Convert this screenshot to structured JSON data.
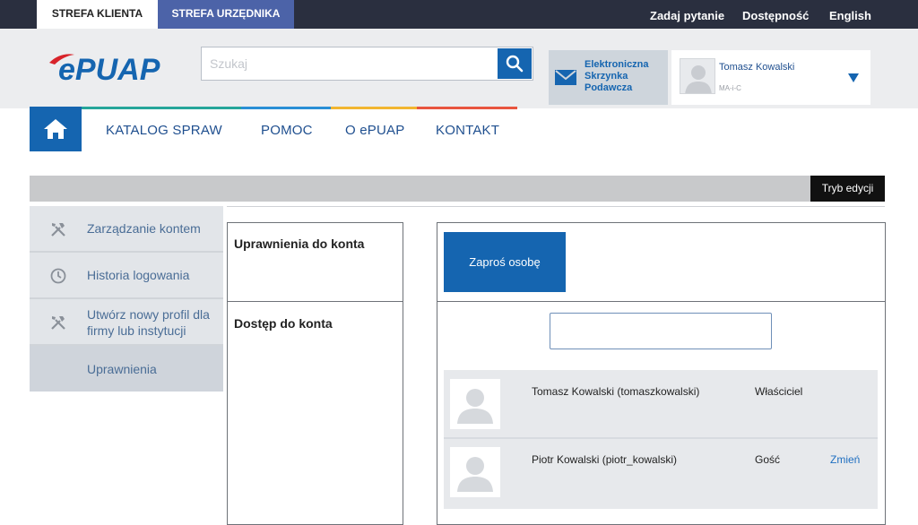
{
  "top_bar": {
    "tab_client": "STREFA KLIENTA",
    "tab_official": "STREFA URZĘDNIKA",
    "links": [
      "Zadaj pytanie",
      "Dostępność",
      "English"
    ]
  },
  "header": {
    "logo_text": "ePUAP",
    "search_placeholder": "Szukaj",
    "esp_label": "Elektroniczna Skrzynka Podawcza",
    "user_name": "Tomasz Kowalski",
    "user_id": "MA-i-C"
  },
  "nav": {
    "items": [
      "KATALOG SPRAW",
      "POMOC",
      "O ePUAP",
      "KONTAKT"
    ]
  },
  "toolbar": {
    "edit_mode": "Tryb edycji"
  },
  "sidebar": {
    "items": [
      {
        "label": "Zarządzanie kontem",
        "icon": "tools-icon"
      },
      {
        "label": "Historia logowania",
        "icon": "clock-icon"
      },
      {
        "label": "Utwórz nowy profil dla firmy lub instytucji",
        "icon": "tools-icon"
      },
      {
        "label": "Uprawnienia",
        "icon": ""
      }
    ]
  },
  "main": {
    "section_account_rights": "Uprawnienia do konta",
    "section_account_access": "Dostęp do konta",
    "invite_button": "Zaproś osobę",
    "filter_value": "",
    "people": [
      {
        "name": "Tomasz Kowalski (tomaszkowalski)",
        "role": "Właściciel",
        "action": ""
      },
      {
        "name": "Piotr Kowalski (piotr_kowalski)",
        "role": "Gość",
        "action": "Zmień"
      }
    ]
  },
  "colors": {
    "brand_blue": "#1565b0",
    "top_bar": "#2a2f3f",
    "official_tab": "#4c63a8",
    "logo_red": "#d8232a"
  }
}
